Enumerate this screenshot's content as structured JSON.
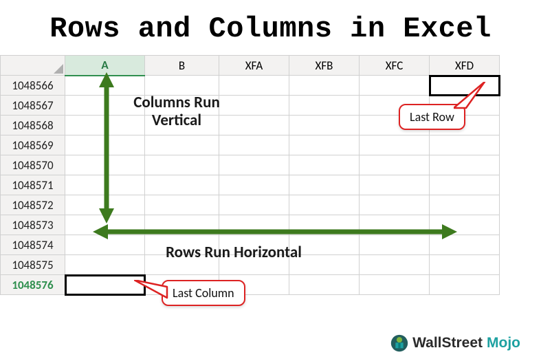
{
  "title": "Rows and Columns in Excel",
  "columns": [
    "A",
    "B",
    "XFA",
    "XFB",
    "XFC",
    "XFD"
  ],
  "rows": [
    "1048566",
    "1048567",
    "1048568",
    "1048569",
    "1048570",
    "1048571",
    "1048572",
    "1048573",
    "1048574",
    "1048575",
    "1048576"
  ],
  "annotation_vertical": "Columns Run\nVertical",
  "annotation_horizontal": "Rows Run Horizontal",
  "callout_last_row": "Last Row",
  "callout_last_column": "Last Column",
  "arrow_color": "#3d7a1e",
  "watermark_brand1": "WallStreet",
  "watermark_brand2": "Mojo"
}
